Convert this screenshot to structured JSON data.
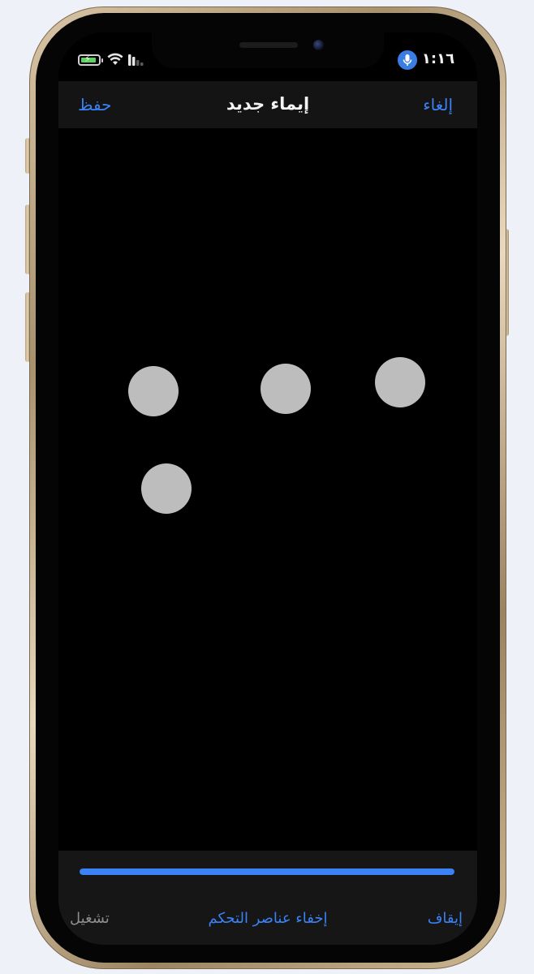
{
  "status_bar": {
    "time": "١:١٦",
    "icons": [
      "battery-charging-icon",
      "wifi-icon",
      "cellular-signal-icon",
      "microphone-icon"
    ]
  },
  "nav": {
    "cancel_label": "إلغاء",
    "title": "إيماء جديد",
    "save_label": "حفظ"
  },
  "gesture": {
    "touch_points": 4
  },
  "timeline": {
    "progress": 1.0
  },
  "toolbar": {
    "stop_label": "إيقاف",
    "hide_controls_label": "إخفاء عناصر التحكم",
    "play_label": "تشغيل"
  },
  "colors": {
    "accent": "#3b82f6",
    "touch_point": "#bdbdbd",
    "background": "#000000",
    "disabled_text": "#8e8e8e"
  }
}
